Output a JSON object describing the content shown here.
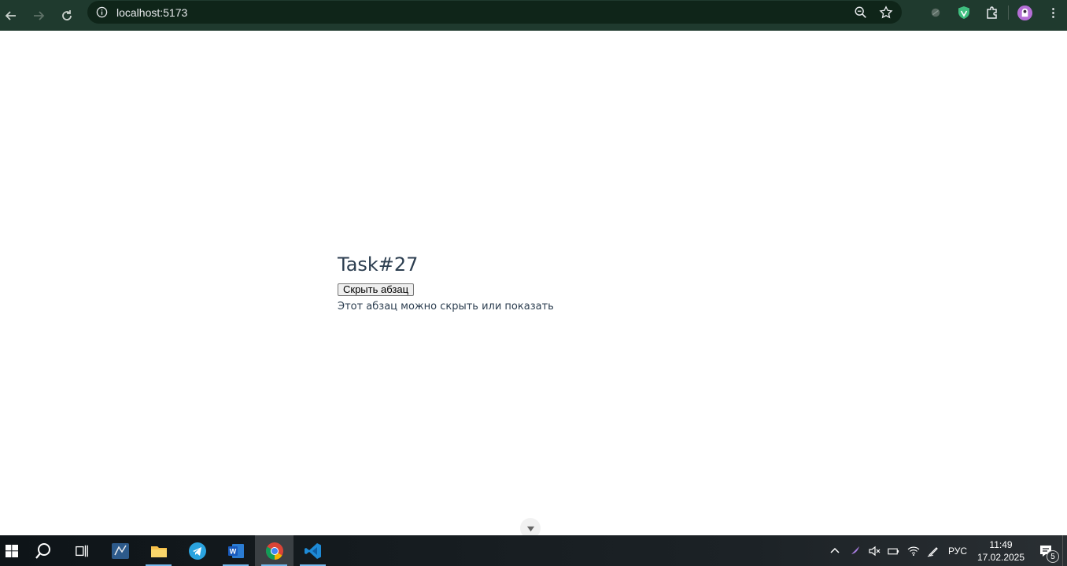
{
  "browser": {
    "url": "localhost:5173",
    "buttons": {
      "back": "back-arrow",
      "forward": "forward-arrow",
      "reload": "reload"
    }
  },
  "page": {
    "title": "Task#27",
    "toggle_button_label": "Скрыть абзац",
    "paragraph": "Этот абзац можно скрыть или показать"
  },
  "taskbar": {
    "apps": [
      "start",
      "search",
      "task-view",
      "visual-studio",
      "file-explorer",
      "telegram",
      "word",
      "chrome",
      "vscode"
    ],
    "language": "РУС",
    "time": "11:49",
    "date": "17.02.2025",
    "notifications_count": "5"
  },
  "colors": {
    "browser_bar": "#1f3a2e",
    "omnibox": "#0f2519",
    "text": "#2c3e50"
  }
}
